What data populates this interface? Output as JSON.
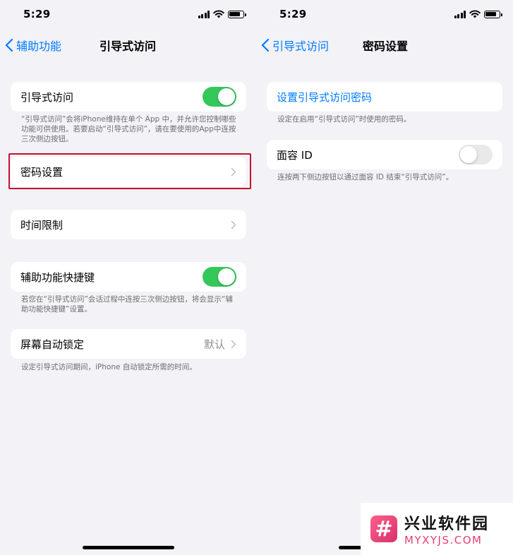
{
  "left": {
    "status": {
      "time": "5:29"
    },
    "nav": {
      "back_label": "辅助功能",
      "title": "引导式访问"
    },
    "guided_access": {
      "label": "引导式访问",
      "enabled": true,
      "footer": "“引导式访问”会将iPhone维持在单个 App 中，并允许您控制哪些功能可供使用。若要启动“引导式访问”，请在要使用的App中连按三次侧边按钮。"
    },
    "passcode_settings": {
      "label": "密码设置"
    },
    "time_limits": {
      "label": "时间限制"
    },
    "accessibility_shortcut": {
      "label": "辅助功能快捷键",
      "enabled": true,
      "footer": "若您在“引导式访问”会话过程中连按三次侧边按钮，将会显示“辅助功能快捷键”设置。"
    },
    "auto_lock": {
      "label": "屏幕自动锁定",
      "value": "默认",
      "footer": "设定引导式访问期间，iPhone 自动锁定所需的时间。"
    }
  },
  "right": {
    "status": {
      "time": "5:29"
    },
    "nav": {
      "back_label": "引导式访问",
      "title": "密码设置"
    },
    "set_passcode": {
      "label": "设置引导式访问密码",
      "footer": "设定在启用“引导式访问”时使用的密码。"
    },
    "face_id": {
      "label": "面容 ID",
      "enabled": false,
      "footer": "连按两下侧边按钮以通过面容 ID 结束“引导式访问”。"
    }
  },
  "watermark": {
    "logo_glyph": "#",
    "cn": "兴业软件园",
    "en": "MYXYJS.COM"
  },
  "colors": {
    "accent": "#007aff",
    "toggle_on": "#34c759",
    "highlight": "#c8102e",
    "watermark_pink": "#e83e6f"
  }
}
